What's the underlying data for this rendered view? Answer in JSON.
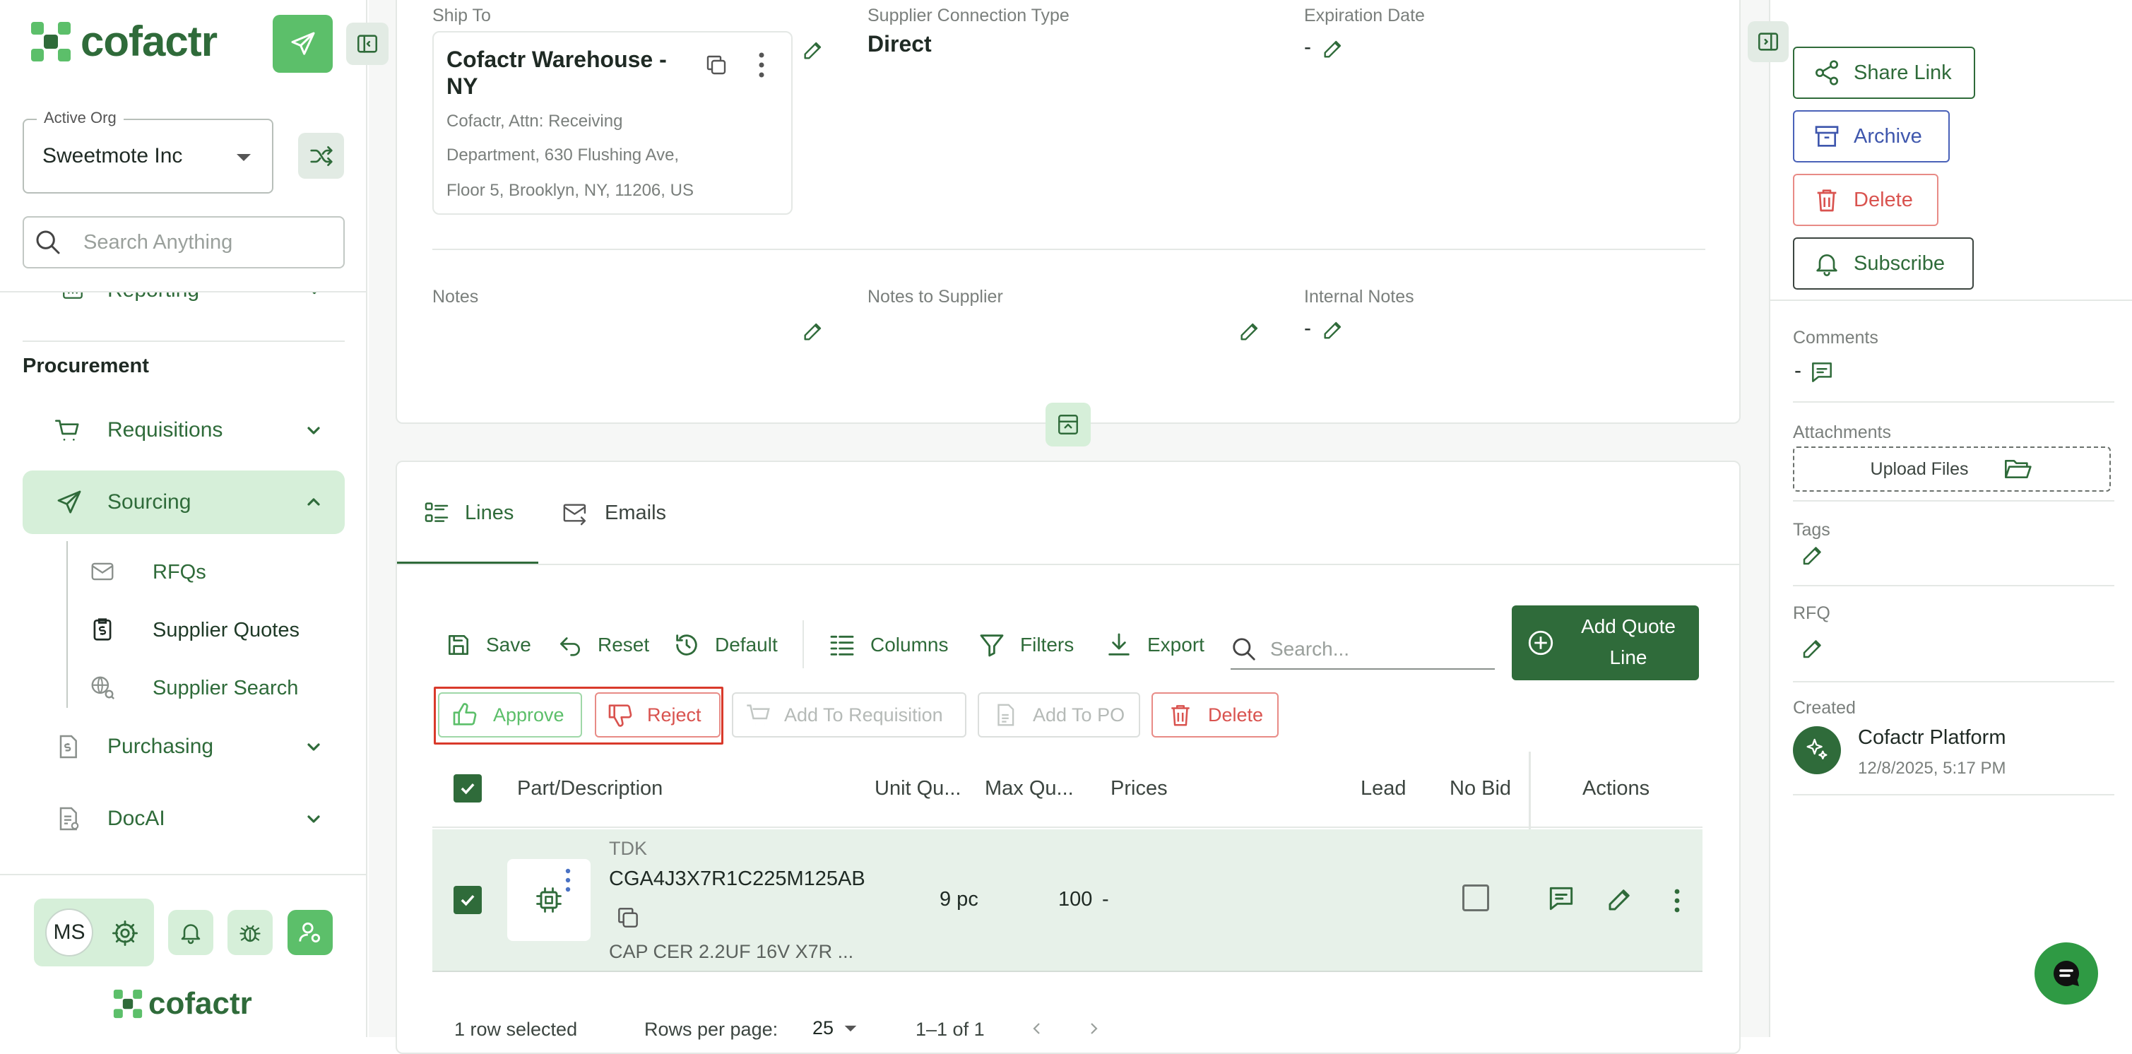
{
  "sidebar": {
    "brand": "cofactr",
    "active_org_label": "Active Org",
    "active_org_value": "Sweetmote Inc",
    "search_placeholder": "Search Anything",
    "reporting_label": "Reporting",
    "section_title": "Procurement",
    "nav": {
      "requisitions": "Requisitions",
      "sourcing": "Sourcing",
      "rfqs": "RFQs",
      "supplier_quotes": "Supplier Quotes",
      "supplier_search": "Supplier Search",
      "purchasing": "Purchasing",
      "docai": "DocAI"
    },
    "user_initials": "MS",
    "footer_brand": "cofactr"
  },
  "details": {
    "ship_to_label": "Ship To",
    "ship_to_name_line1": "Cofactr Warehouse -",
    "ship_to_name_line2": "NY",
    "ship_to_addr1": "Cofactr, Attn: Receiving",
    "ship_to_addr2": "Department, 630 Flushing Ave,",
    "ship_to_addr3": "Floor 5, Brooklyn, NY, 11206, US",
    "connection_label": "Supplier Connection Type",
    "connection_value": "Direct",
    "expiration_label": "Expiration Date",
    "expiration_value": "-",
    "notes_label": "Notes",
    "notes_supplier_label": "Notes to Supplier",
    "internal_notes_label": "Internal Notes",
    "internal_notes_value": "-"
  },
  "tabs": {
    "lines": "Lines",
    "emails": "Emails"
  },
  "toolbar": {
    "save": "Save",
    "reset": "Reset",
    "default": "Default",
    "columns": "Columns",
    "filters": "Filters",
    "export": "Export",
    "search_placeholder": "Search...",
    "add_quote_line1": "Add Quote",
    "add_quote_line2": "Line"
  },
  "actions": {
    "approve": "Approve",
    "reject": "Reject",
    "add_to_requisition": "Add To Requisition",
    "add_to_po": "Add To PO",
    "delete": "Delete"
  },
  "table": {
    "headers": {
      "part": "Part/Description",
      "unit_qty": "Unit Qu...",
      "max_qty": "Max Qu...",
      "prices": "Prices",
      "lead": "Lead",
      "no_bid": "No Bid",
      "actions": "Actions"
    },
    "row": {
      "manufacturer": "TDK",
      "part_number": "CGA4J3X7R1C225M125AB",
      "description": "CAP CER 2.2UF 16V X7R ...",
      "unit_qty": "9 pc",
      "max_qty": "100",
      "prices": "-"
    },
    "footer": {
      "selected": "1 row selected",
      "rows_per_page_label": "Rows per page:",
      "rows_per_page_value": "25",
      "range": "1–1 of 1"
    }
  },
  "right_panel": {
    "share_link": "Share Link",
    "archive": "Archive",
    "delete": "Delete",
    "subscribe": "Subscribe",
    "comments_label": "Comments",
    "comments_value": "-",
    "attachments_label": "Attachments",
    "upload_files": "Upload Files",
    "tags_label": "Tags",
    "rfq_label": "RFQ",
    "created_label": "Created",
    "created_by": "Cofactr Platform",
    "created_at": "12/8/2025, 5:17 PM"
  },
  "colors": {
    "brand_green": "#2f6b3a",
    "light_green": "#d6efd9",
    "bright_green": "#5cbf6a",
    "danger": "#d9534f",
    "highlight": "#d93a2b"
  }
}
